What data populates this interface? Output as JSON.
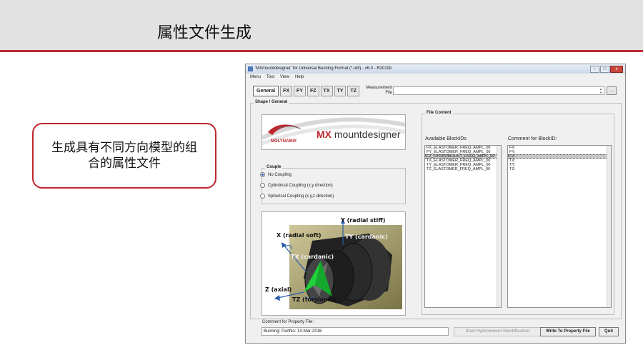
{
  "slide": {
    "title": "属性文件生成",
    "callout": "生成具有不同方向模型的组合的属性文件"
  },
  "window": {
    "title": "'MXmountdesigner' for Universal Bushing Format (*.ubf) - v6.0 - R2011b",
    "controls": {
      "minimize": "–",
      "maximize": "□",
      "close": "x"
    },
    "menu": [
      "Menu",
      "Tool",
      "View",
      "Help"
    ],
    "tabs": [
      "General",
      "FX",
      "FY",
      "FZ",
      "TX",
      "TY",
      "TZ"
    ],
    "active_tab": "General",
    "measurement": {
      "label": "Measurement File",
      "value": "",
      "browse_label": "..."
    },
    "shape_group": {
      "label": "Shape / General"
    },
    "logo": {
      "brand": "mountdesigner",
      "prefix": "MX",
      "company": "MOLYNAMIX"
    },
    "couple": {
      "label": "Couple",
      "options": [
        "No Coupling",
        "Cylindrical Coupling (x,y direction)",
        "Spherical Coupling (x,y,z direction)"
      ],
      "selected": "No Coupling"
    },
    "diagram_labels": {
      "y": "Y (radial stiff)",
      "x": "X (radial soft)",
      "ty": "TY (cardanic)",
      "tx": "TX (cardanic)",
      "z": "Z (axial)",
      "tz": "TZ (torsional)"
    },
    "file_content": {
      "label": "File Content",
      "available_label": "Available BlockIDs",
      "comment_label": "Comment for BlockID:",
      "blocks": [
        "FX_ELASTOMER_FREQ_AMPL_00",
        "FY_ELASTOMER_FREQ_AMPL_00",
        "FZ_HYDROMOUNT_FREQ_AMPL_00",
        "TX_ELASTOMER_FREQ_AMPL_00",
        "TY_ELASTOMER_FREQ_AMPL_00",
        "TZ_ELASTOMER_FREQ_AMPL_00"
      ],
      "comments": [
        "FX:",
        "FY:",
        "FZ:",
        "TX:",
        "TY:",
        "TZ:"
      ],
      "selected_index": 2
    },
    "comment": {
      "label": "Comment for Property File:",
      "value": "Bushing: PartNo: 14-Mar-2016"
    },
    "buttons": {
      "hydromount": "Start Hydromount Identification",
      "write": "Write To Property File",
      "quit": "Quit"
    }
  }
}
